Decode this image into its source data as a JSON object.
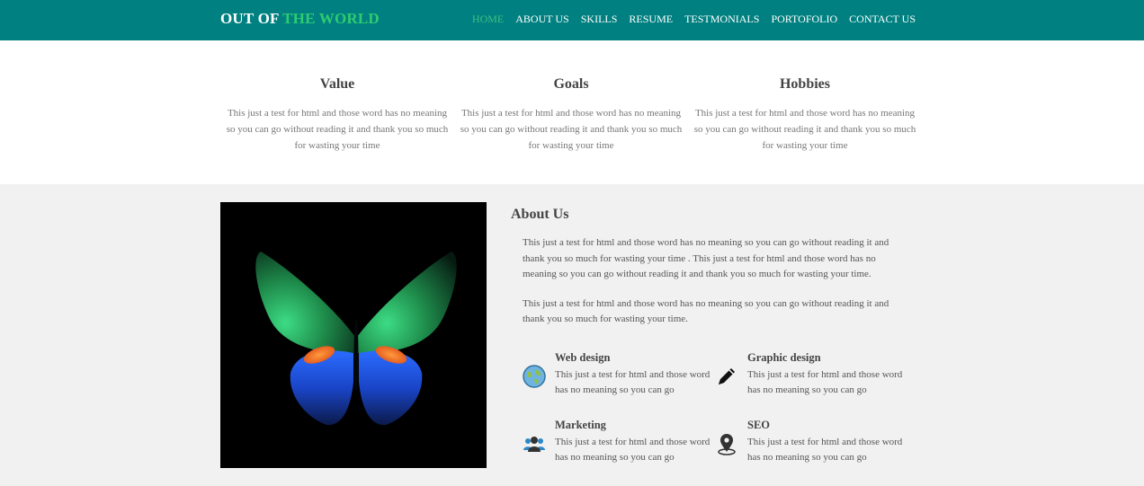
{
  "brand": {
    "part1": "OUT OF",
    "part2": "THE WORLD"
  },
  "nav": {
    "items": [
      "HOME",
      "ABOUT US",
      "SKILLS",
      "RESUME",
      "TESTMONIALS",
      "PORTOFOLIO",
      "CONTACT US"
    ],
    "active": "HOME"
  },
  "features": [
    {
      "title": "Value",
      "text": "This just a test for html and those word has no meaning so you can go without reading it and thank you so much for wasting your time"
    },
    {
      "title": "Goals",
      "text": "This just a test for html and those word has no meaning so you can go without reading it and thank you so much for wasting your time"
    },
    {
      "title": "Hobbies",
      "text": "This just a test for html and those word has no meaning so you can go without reading it and thank you so much for wasting your time"
    }
  ],
  "about": {
    "title": "About Us",
    "para1": "This just a test for html and those word has no meaning so you can go without reading it and thank you so much for wasting your time . This just a test for html and those word has no meaning so you can go without reading it and thank you so much for wasting your time.",
    "para2": "This just a test for html and those word has no meaning so you can go without reading it and thank you so much for wasting your time.",
    "services": [
      {
        "title": "Web design",
        "text": "This just a test for html and those word has no meaning so you can go",
        "icon": "globe-icon"
      },
      {
        "title": "Graphic design",
        "text": "This just a test for html and those word has no meaning so you can go",
        "icon": "pencil-icon"
      },
      {
        "title": "Marketing",
        "text": "This just a test for html and those word has no meaning so you can go",
        "icon": "users-icon"
      },
      {
        "title": "SEO",
        "text": "This just a test for html and those word has no meaning so you can go",
        "icon": "location-pin-icon"
      }
    ]
  },
  "colors": {
    "navbar": "#008080",
    "accent": "#2ecc71",
    "section_bg": "#f1f1f1"
  }
}
